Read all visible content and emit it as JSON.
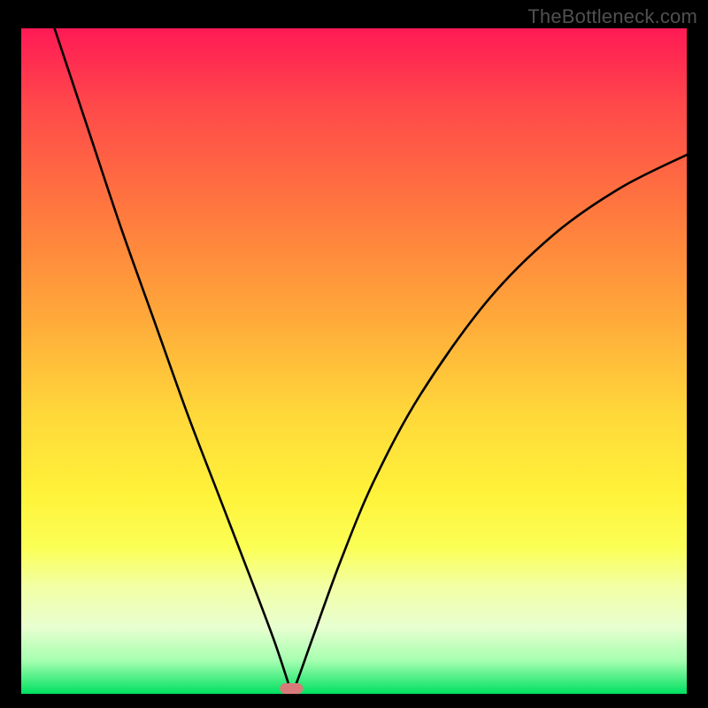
{
  "watermark": "TheBottleneck.com",
  "chart_data": {
    "type": "line",
    "title": "",
    "xlabel": "",
    "ylabel": "",
    "xlim": [
      0,
      1
    ],
    "ylim": [
      0,
      1
    ],
    "grid": false,
    "curve": {
      "description": "V-shaped bottleneck curve with a single minimum",
      "minimum_x": 0.406,
      "minimum_y": 0.0,
      "x": [
        0.0,
        0.05,
        0.1,
        0.15,
        0.2,
        0.25,
        0.3,
        0.35,
        0.38,
        0.4,
        0.406,
        0.415,
        0.44,
        0.48,
        0.53,
        0.6,
        0.7,
        0.8,
        0.9,
        1.0
      ],
      "y": [
        1.15,
        1.0,
        0.85,
        0.7,
        0.56,
        0.42,
        0.29,
        0.16,
        0.08,
        0.02,
        0.0,
        0.02,
        0.09,
        0.2,
        0.32,
        0.45,
        0.59,
        0.69,
        0.76,
        0.81
      ]
    },
    "marker": {
      "shape": "rounded-pill",
      "x": 0.406,
      "y": 0.005,
      "color": "#d97a7a"
    },
    "background_gradient": {
      "type": "vertical",
      "stops": [
        {
          "pos": 0.0,
          "color": "#ff1a55"
        },
        {
          "pos": 0.5,
          "color": "#ffb03a"
        },
        {
          "pos": 0.75,
          "color": "#fff23a"
        },
        {
          "pos": 1.0,
          "color": "#00e060"
        }
      ]
    }
  }
}
